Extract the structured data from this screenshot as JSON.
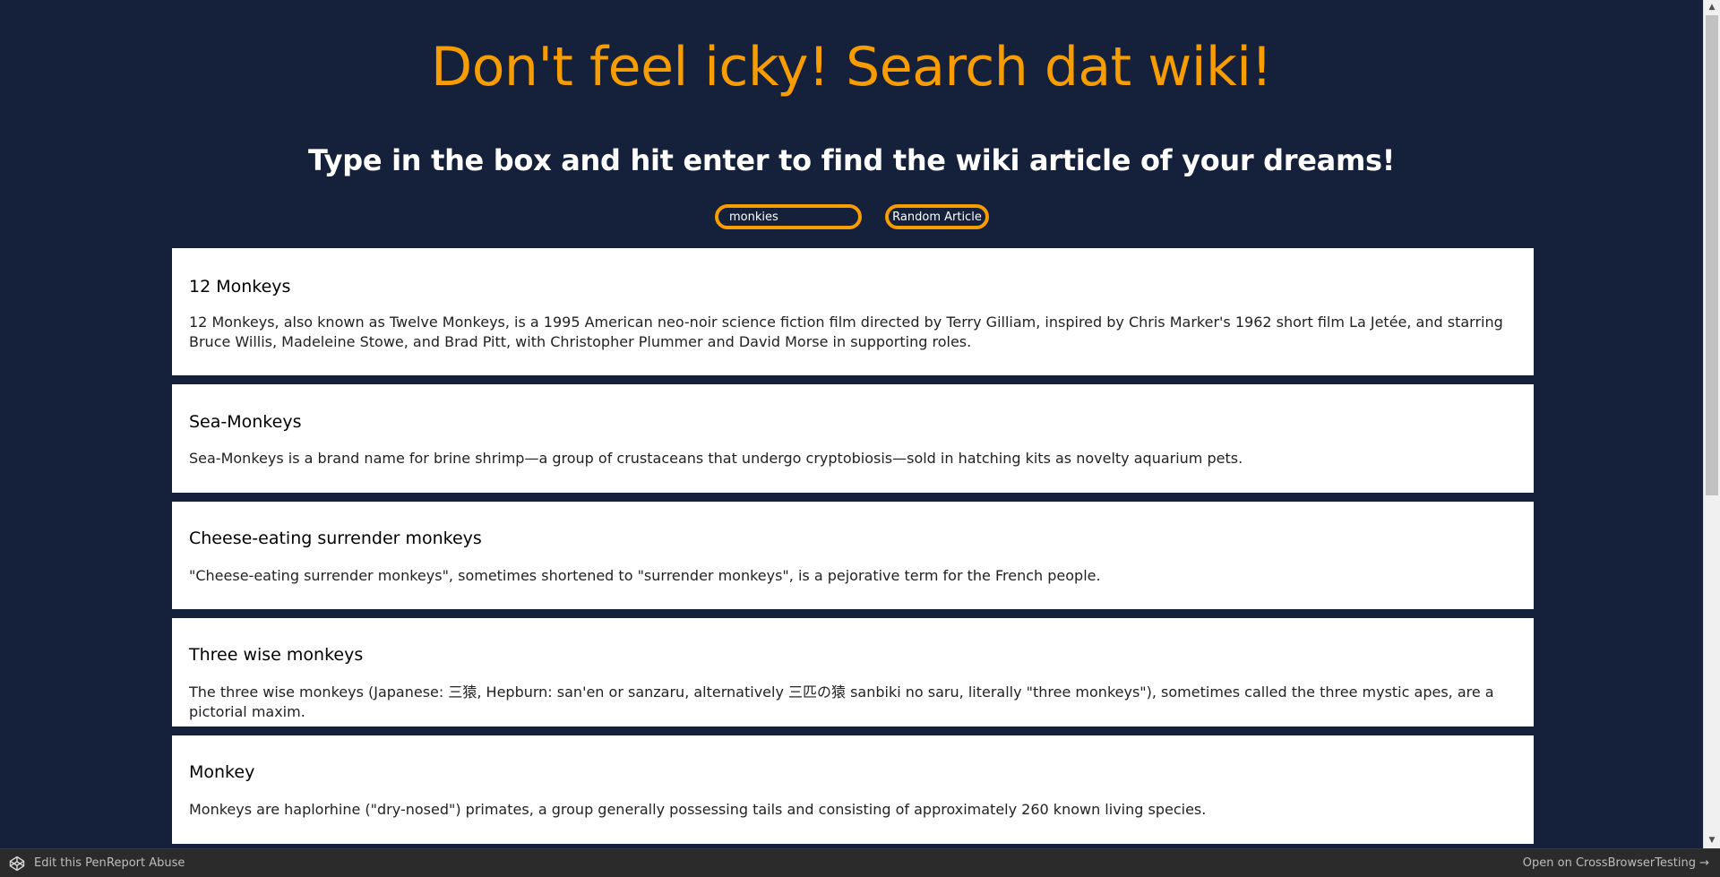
{
  "header": {
    "title": "Don't feel icky! Search dat wiki!",
    "subtitle": "Type in the box and hit enter to find the wiki article of your dreams!"
  },
  "search": {
    "value": "monkies",
    "random_label": "Random Article"
  },
  "results": [
    {
      "title": "12 Monkeys",
      "description": "12 Monkeys, also known as Twelve Monkeys, is a 1995 American neo-noir science fiction film directed by Terry Gilliam, inspired by Chris Marker's 1962 short film La Jetée, and starring Bruce Willis, Madeleine Stowe, and Brad Pitt, with Christopher Plummer and David Morse in supporting roles."
    },
    {
      "title": "Sea-Monkeys",
      "description": "Sea-Monkeys is a brand name for brine shrimp—a group of crustaceans that undergo cryptobiosis—sold in hatching kits as novelty aquarium pets."
    },
    {
      "title": "Cheese-eating surrender monkeys",
      "description": "\"Cheese-eating surrender monkeys\", sometimes shortened to \"surrender monkeys\", is a pejorative term for the French people."
    },
    {
      "title": "Three wise monkeys",
      "description": "The three wise monkeys (Japanese: 三猿, Hepburn: san'en or sanzaru, alternatively 三匹の猿 sanbiki no saru, literally \"three monkeys\"), sometimes called the three mystic apes, are a pictorial maxim."
    },
    {
      "title": "Monkey",
      "description": "Monkeys are haplorhine (\"dry-nosed\") primates, a group generally possessing tails and consisting of approximately 260 known living species."
    }
  ],
  "footer": {
    "edit_label": "Edit this Pen",
    "report_label": "Report Abuse",
    "open_label": "Open on CrossBrowserTesting →"
  },
  "colors": {
    "background": "#15203a",
    "accent": "#f79d00",
    "card": "#ffffff",
    "footer": "#2b2b2b"
  },
  "icons": {
    "footer_logo": "codepen-icon",
    "scroll_up": "scroll-up-arrow-icon",
    "scroll_down": "scroll-down-arrow-icon"
  }
}
